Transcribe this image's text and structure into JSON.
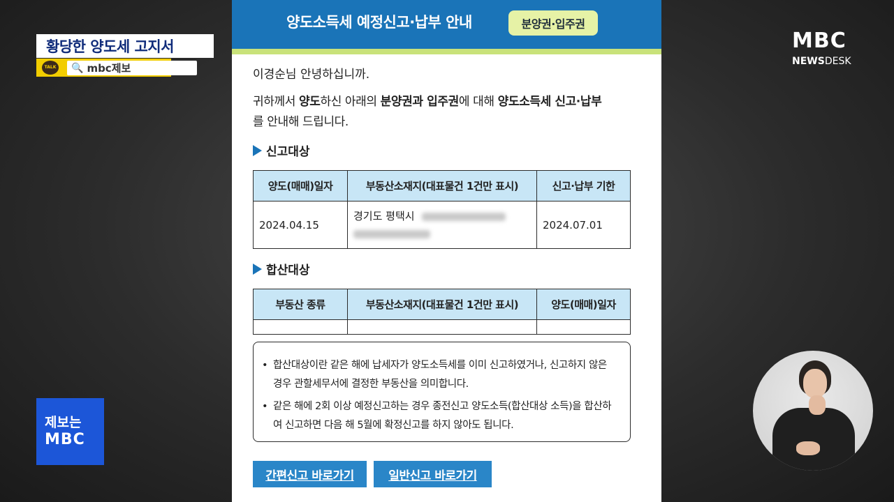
{
  "document": {
    "title": "양도소득세 예정신고·납부 안내",
    "badge": "분양권·입주권",
    "greeting": "이경순님 안녕하십니까.",
    "intro": {
      "part1": "귀하께서 ",
      "bold1": "양도",
      "part2": "하신 아래의 ",
      "bold2": "분양권과 입주권",
      "part3": "에 대해 ",
      "bold3": "양도소득세 신고·납부",
      "part4": "를 안내해 드립니다."
    },
    "section_report": {
      "title": "신고대상",
      "headers": [
        "양도(매매)일자",
        "부동산소재지(대표물건 1건만 표시)",
        "신고·납부 기한"
      ],
      "row": {
        "date": "2024.04.15",
        "location": "경기도 평택시",
        "deadline": "2024.07.01"
      }
    },
    "section_combined": {
      "title": "합산대상",
      "headers": [
        "부동산 종류",
        "부동산소재지(대표물건 1건만 표시)",
        "양도(매매)일자"
      ]
    },
    "notes": [
      "합산대상이란 같은 해에 납세자가 양도소득세를 이미 신고하였거나, 신고하지 않은 경우 관할세무서에 결정한 부동산을 의미합니다.",
      "같은 해에 2회 이상 예정신고하는 경우 종전신고 양도소득(합산대상 소득)을 합산하여 신고하면 다음 해 5월에 확정신고를 하지 않아도 됩니다."
    ],
    "buttons": {
      "simple": "간편신고 바로가기",
      "general": "일반신고 바로가기"
    }
  },
  "overlay": {
    "caption": "황당한 양도세 고지서",
    "talk_icon_text": "TALK",
    "talk_search": "mbc제보",
    "logo": "MBC",
    "newsdesk_bold": "NEWS",
    "newsdesk_rest": "DESK",
    "jebo_line1": "제보는",
    "jebo_line2": "MBC"
  },
  "colors": {
    "header_blue": "#1a74b8",
    "header_stripe": "#c9e27a",
    "badge_bg": "#e6f2a6",
    "table_header": "#c8e6f6",
    "button_blue": "#2a86c8",
    "caption_text": "#0f2b7a",
    "kakao_yellow": "#f2cd00",
    "jebo_blue": "#1c56d8"
  }
}
